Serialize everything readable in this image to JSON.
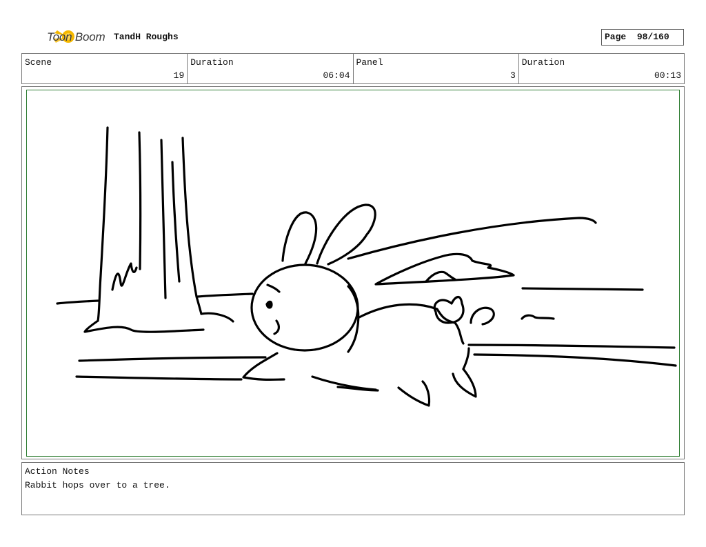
{
  "header": {
    "logo_text": "Toon Boom",
    "project_title": "TandH Roughs",
    "page_label": "Page",
    "page_value": "98/160"
  },
  "info": {
    "scene_label": "Scene",
    "scene_value": "19",
    "duration_label": "Duration",
    "duration_value": "06:04",
    "panel_label": "Panel",
    "panel_value": "3",
    "panel_duration_label": "Duration",
    "panel_duration_value": "00:13"
  },
  "notes": {
    "label": "Action Notes",
    "text": "Rabbit hops over to a tree."
  },
  "colors": {
    "panel_border": "#2e7d32",
    "logo_accent": "#f5b800"
  }
}
